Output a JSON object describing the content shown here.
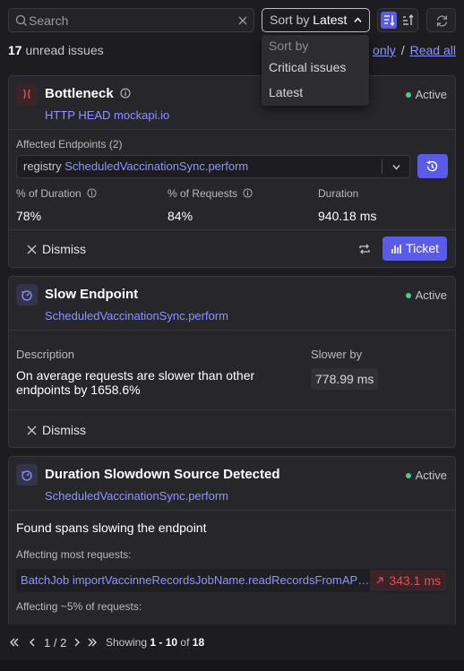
{
  "search": {
    "placeholder": "Search"
  },
  "sort": {
    "label": "Sort by",
    "value": "Latest",
    "menu": {
      "header": "Sort by",
      "options": [
        "Critical issues",
        "Latest"
      ]
    }
  },
  "summary": {
    "count": "17",
    "text": "unread issues",
    "link_partial": "only",
    "separator": "/",
    "read_all": "Read all"
  },
  "cards": [
    {
      "title": "Bottleneck",
      "subtitle": "HTTP HEAD mockapi.io",
      "status": "Active",
      "affected_label": "Affected Endpoints (2)",
      "endpoint_prefix": "registry",
      "endpoint": "ScheduledVaccinationSync.perform",
      "metrics": [
        {
          "label": "% of Duration",
          "value": "78%"
        },
        {
          "label": "% of Requests",
          "value": "84%"
        },
        {
          "label": "Duration",
          "value": "940.18 ms"
        }
      ],
      "dismiss": "Dismiss",
      "ticket": "Ticket"
    },
    {
      "title": "Slow Endpoint",
      "subtitle": "ScheduledVaccinationSync.perform",
      "status": "Active",
      "desc_label": "Description",
      "desc_line1": "On average requests are slower than other",
      "desc_line2": "endpoints by 1658.6%",
      "slower_label": "Slower by",
      "slower_value": "778.99 ms",
      "dismiss": "Dismiss"
    },
    {
      "title": "Duration Slowdown Source Detected",
      "subtitle": "ScheduledVaccinationSync.perform",
      "status": "Active",
      "found_text": "Found spans slowing the endpoint",
      "most_label": "Affecting most requests:",
      "span_name": "BatchJob importVaccinneRecordsJobName.readRecordsFromAPIA...",
      "span_time": "343.1 ms",
      "pct_label": "Affecting ~5% of requests:"
    }
  ],
  "pagination": {
    "page": "1 / 2",
    "showing": "Showing",
    "range": "1 - 10",
    "of": "of",
    "total": "18"
  },
  "colors": {
    "background": "#1d1d21",
    "card": "#26262b",
    "accent": "#5a5ce6",
    "link": "#8f94ff",
    "active": "#4ec98a",
    "danger": "#e04e5c"
  }
}
